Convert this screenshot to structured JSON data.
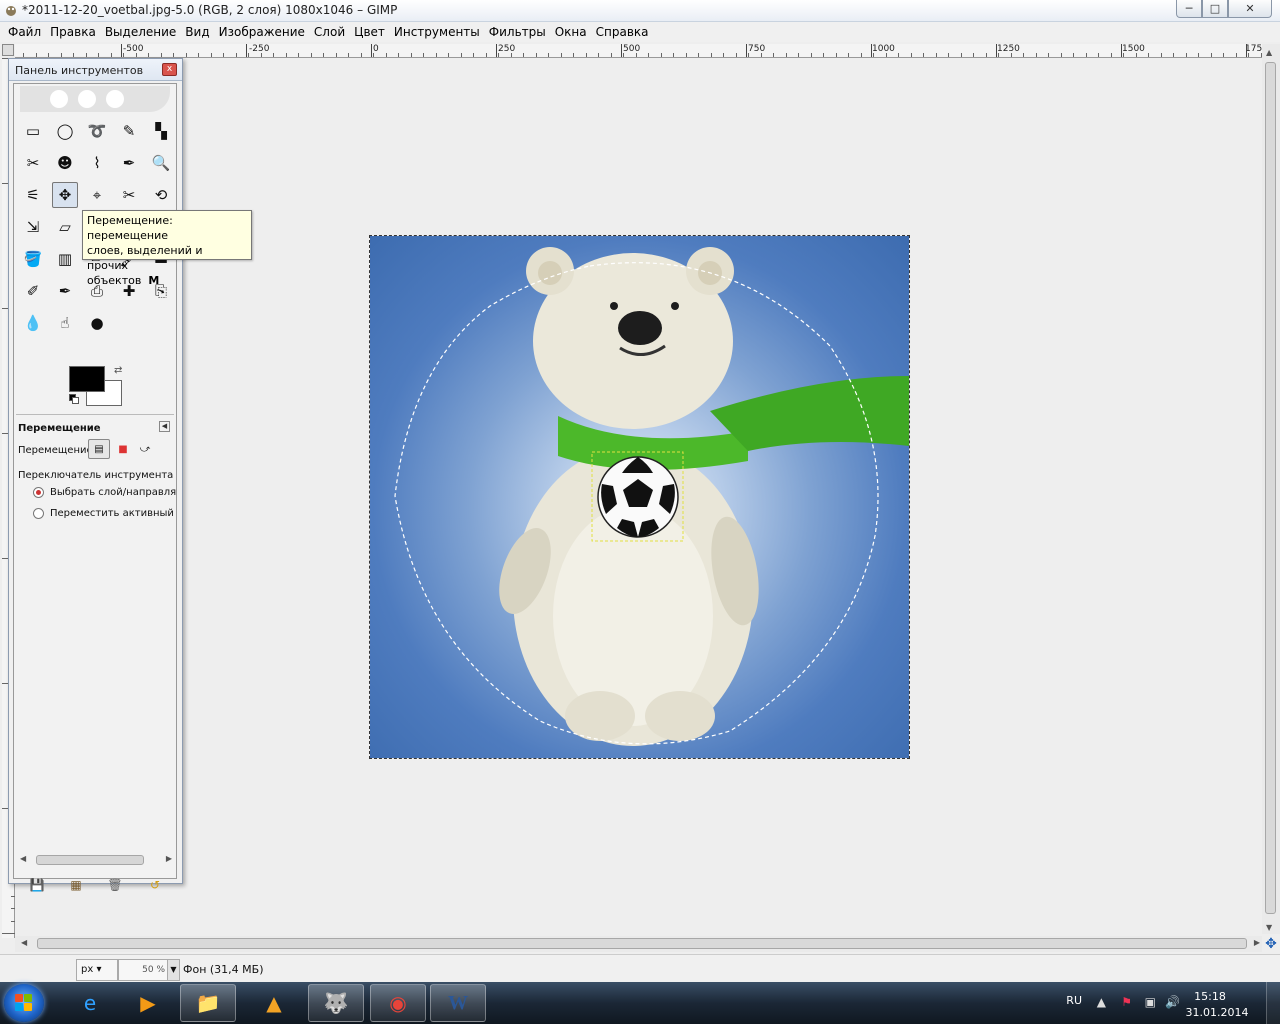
{
  "window": {
    "title": "*2011-12-20_voetbal.jpg-5.0 (RGB, 2 слоя) 1080x1046 – GIMP",
    "buttons": {
      "minimize": "─",
      "maximize": "□",
      "close": "✕"
    }
  },
  "menubar": {
    "items": [
      "Файл",
      "Правка",
      "Выделение",
      "Вид",
      "Изображение",
      "Слой",
      "Цвет",
      "Инструменты",
      "Фильтры",
      "Окна",
      "Справка"
    ]
  },
  "ruler_top": {
    "labels": [
      "-500",
      "-250",
      "0",
      "250",
      "500",
      "750",
      "1000",
      "1250",
      "1500",
      "175"
    ]
  },
  "toolbox": {
    "title": "Панель инструментов",
    "close": "x",
    "tools": [
      {
        "icon": "rect-select-icon",
        "glyph": "▭"
      },
      {
        "icon": "ellipse-select-icon",
        "glyph": "◯"
      },
      {
        "icon": "free-select-icon",
        "glyph": "➰"
      },
      {
        "icon": "fuzzy-select-icon",
        "glyph": "✎"
      },
      {
        "icon": "select-by-color-icon",
        "glyph": "▚"
      },
      {
        "icon": "scissors-select-icon",
        "glyph": "✂"
      },
      {
        "icon": "foreground-select-icon",
        "glyph": "☻"
      },
      {
        "icon": "paths-icon",
        "glyph": "⌇"
      },
      {
        "icon": "color-picker-icon",
        "glyph": "✒"
      },
      {
        "icon": "zoom-icon",
        "glyph": "🔍"
      },
      {
        "icon": "measure-icon",
        "glyph": "⚟"
      },
      {
        "icon": "move-icon",
        "glyph": "✥"
      },
      {
        "icon": "align-icon",
        "glyph": "⌖"
      },
      {
        "icon": "crop-icon",
        "glyph": "✂"
      },
      {
        "icon": "rotate-icon",
        "glyph": "⟲"
      },
      {
        "icon": "scale-icon",
        "glyph": "⇲"
      },
      {
        "icon": "shear-icon",
        "glyph": "▱"
      },
      {
        "icon": "perspective-icon",
        "glyph": "⏢"
      },
      {
        "icon": "flip-icon",
        "glyph": "⇆"
      },
      {
        "icon": "cage-icon",
        "glyph": "⬡"
      },
      {
        "icon": "bucket-fill-icon",
        "glyph": "🪣"
      },
      {
        "icon": "blend-icon",
        "glyph": "▥"
      },
      {
        "icon": "pencil-icon",
        "glyph": "✏"
      },
      {
        "icon": "paintbrush-icon",
        "glyph": "🖌"
      },
      {
        "icon": "eraser-icon",
        "glyph": "▬"
      },
      {
        "icon": "airbrush-icon",
        "glyph": "✐"
      },
      {
        "icon": "ink-icon",
        "glyph": "✒"
      },
      {
        "icon": "clone-icon",
        "glyph": "⎙"
      },
      {
        "icon": "heal-icon",
        "glyph": "✚"
      },
      {
        "icon": "perspective-clone-icon",
        "glyph": "⎘"
      },
      {
        "icon": "blur-icon",
        "glyph": "💧"
      },
      {
        "icon": "smudge-icon",
        "glyph": "☝"
      },
      {
        "icon": "dodge-burn-icon",
        "glyph": "●"
      }
    ],
    "fg_color": "#000000",
    "bg_color": "#ffffff",
    "options": {
      "title": "Перемещение",
      "move_label": "Перемещение:",
      "switch_label": "Переключатель инструмента  (Shi",
      "radio_pick": "Выбрать слой/направляющ",
      "radio_active": "Переместить активный сло"
    }
  },
  "tooltip": {
    "line1": "Перемещение: перемещение",
    "line2": "слоев, выделений и прочих",
    "line3": "объектов",
    "shortcut": "M"
  },
  "statusbar": {
    "unit": "px",
    "zoom": "50 %",
    "layer_info": "Фон (31,4 МБ)"
  },
  "taskbar": {
    "apps": [
      {
        "name": "internet-explorer",
        "glyph": "e",
        "state": "pinned"
      },
      {
        "name": "media-player",
        "glyph": "▶",
        "state": "pinned"
      },
      {
        "name": "explorer",
        "glyph": "📁",
        "state": "running"
      },
      {
        "name": "aimp",
        "glyph": "▲",
        "state": "pinned"
      },
      {
        "name": "gimp",
        "glyph": "🐺",
        "state": "running"
      },
      {
        "name": "chrome",
        "glyph": "◉",
        "state": "running"
      },
      {
        "name": "word",
        "glyph": "W",
        "state": "running"
      }
    ],
    "lang": "RU",
    "time": "15:18",
    "date": "31.01.2014"
  },
  "colors": {
    "image_bg": "#4f7cbf",
    "scarf": "#4cb82a",
    "tooltip_bg": "#ffffe1",
    "taskbar": "#1b2736"
  }
}
